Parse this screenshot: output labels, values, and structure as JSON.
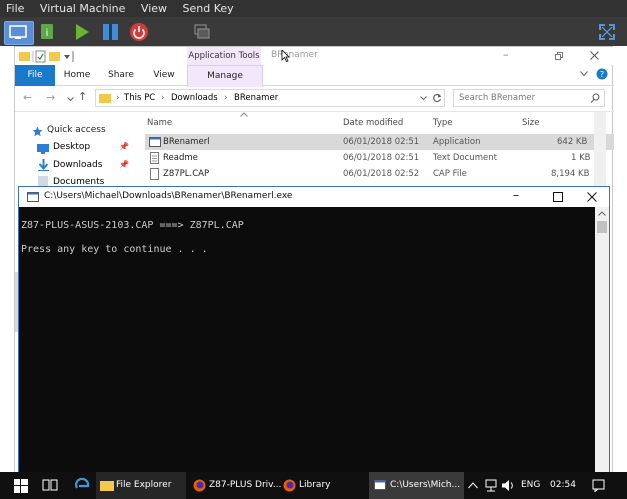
{
  "host": {
    "menu": [
      "File",
      "Virtual Machine",
      "View",
      "Send Key"
    ],
    "colors": {
      "menubar_bg": "#323232",
      "toolbar_bg": "#3a3a3a",
      "play": "#69b335",
      "pause": "#3c8fd6",
      "power": "#d63b3b"
    }
  },
  "explorer": {
    "window_title": "BRenamer",
    "ribbon": {
      "tabs": [
        "File",
        "Home",
        "Share",
        "View",
        "Manage"
      ],
      "app_tools": "Application Tools"
    },
    "address": {
      "crumbs": [
        "This PC",
        "Downloads",
        "BRenamer"
      ],
      "search_placeholder": "Search BRenamer"
    },
    "nav": {
      "quick_access": "Quick access",
      "items": [
        "Desktop",
        "Downloads",
        "Documents"
      ]
    },
    "columns": [
      "Name",
      "Date modified",
      "Type",
      "Size"
    ],
    "files": [
      {
        "name": "BRenamerl",
        "date": "06/01/2018 02:51",
        "type": "Application",
        "size": "642 KB"
      },
      {
        "name": "Readme",
        "date": "06/01/2018 02:51",
        "type": "Text Document",
        "size": "1 KB"
      },
      {
        "name": "Z87PL.CAP",
        "date": "06/01/2018 02:52",
        "type": "CAP File",
        "size": "8,194 KB"
      }
    ]
  },
  "console": {
    "title": "C:\\Users\\Michael\\Downloads\\BRenamer\\BRenamerl.exe",
    "lines": [
      "Z87-PLUS-ASUS-2103.CAP ===> Z87PL.CAP",
      "Press any key to continue . . ."
    ]
  },
  "taskbar": {
    "items": [
      "File Explorer",
      "Z87-PLUS Driv...",
      "Library",
      "C:\\Users\\Mich..."
    ],
    "lang": "ENG",
    "time": "02:54"
  }
}
